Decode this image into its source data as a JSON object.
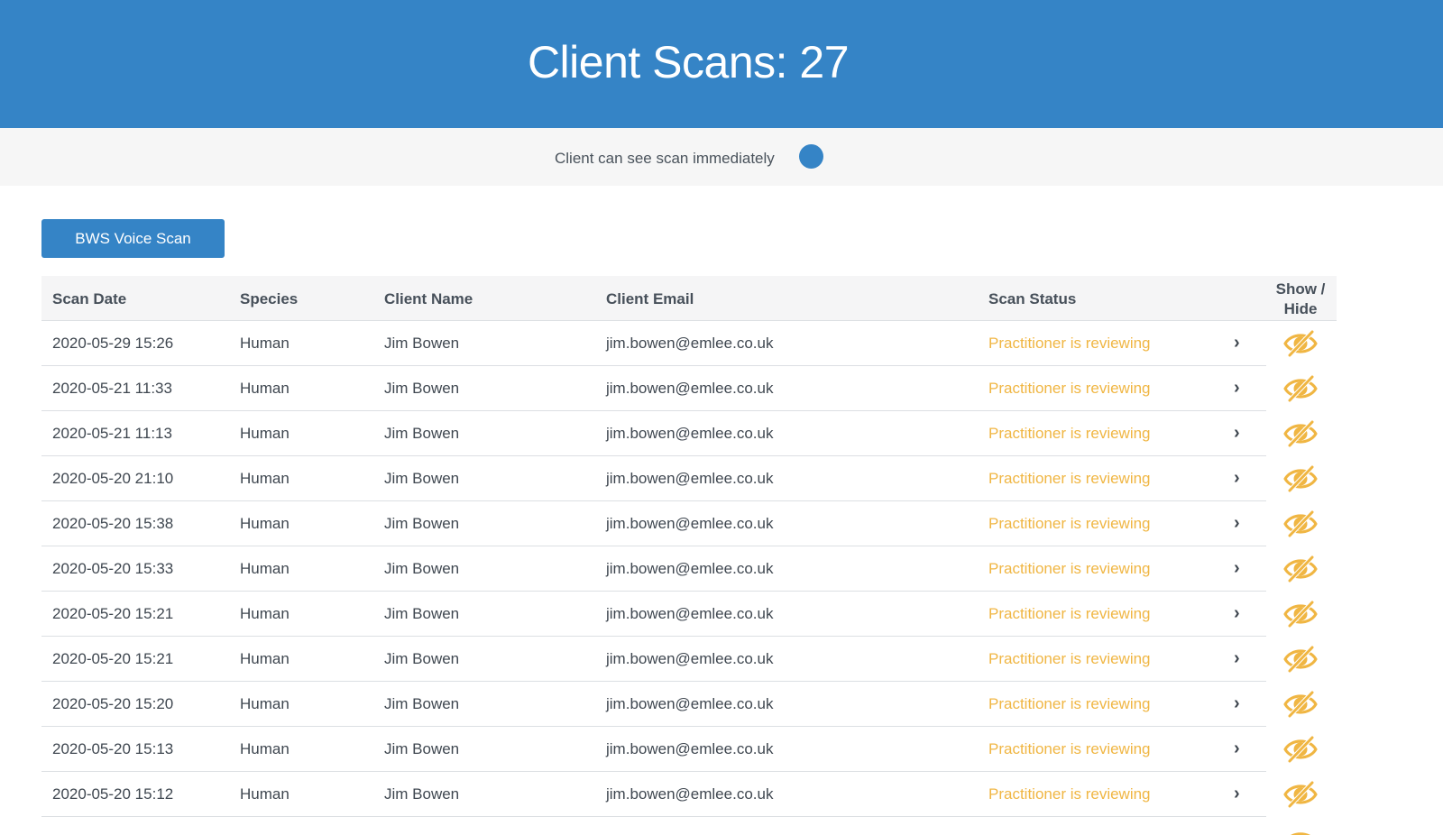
{
  "header": {
    "title": "Client Scans: 27"
  },
  "toggle": {
    "label": "Client can see scan immediately",
    "color": "#3584c6"
  },
  "actions": {
    "scan_button_label": "BWS Voice Scan"
  },
  "table": {
    "columns": {
      "scan_date": "Scan Date",
      "species": "Species",
      "client_name": "Client Name",
      "client_email": "Client Email",
      "scan_status": "Scan Status",
      "show_hide_line1": "Show /",
      "show_hide_line2": "Hide"
    },
    "rows": [
      {
        "date": "2020-05-29 15:26",
        "species": "Human",
        "name": "Jim Bowen",
        "email": "jim.bowen@emlee.co.uk",
        "status": "Practitioner is reviewing"
      },
      {
        "date": "2020-05-21 11:33",
        "species": "Human",
        "name": "Jim Bowen",
        "email": "jim.bowen@emlee.co.uk",
        "status": "Practitioner is reviewing"
      },
      {
        "date": "2020-05-21 11:13",
        "species": "Human",
        "name": "Jim Bowen",
        "email": "jim.bowen@emlee.co.uk",
        "status": "Practitioner is reviewing"
      },
      {
        "date": "2020-05-20 21:10",
        "species": "Human",
        "name": "Jim Bowen",
        "email": "jim.bowen@emlee.co.uk",
        "status": "Practitioner is reviewing"
      },
      {
        "date": "2020-05-20 15:38",
        "species": "Human",
        "name": "Jim Bowen",
        "email": "jim.bowen@emlee.co.uk",
        "status": "Practitioner is reviewing"
      },
      {
        "date": "2020-05-20 15:33",
        "species": "Human",
        "name": "Jim Bowen",
        "email": "jim.bowen@emlee.co.uk",
        "status": "Practitioner is reviewing"
      },
      {
        "date": "2020-05-20 15:21",
        "species": "Human",
        "name": "Jim Bowen",
        "email": "jim.bowen@emlee.co.uk",
        "status": "Practitioner is reviewing"
      },
      {
        "date": "2020-05-20 15:21",
        "species": "Human",
        "name": "Jim Bowen",
        "email": "jim.bowen@emlee.co.uk",
        "status": "Practitioner is reviewing"
      },
      {
        "date": "2020-05-20 15:20",
        "species": "Human",
        "name": "Jim Bowen",
        "email": "jim.bowen@emlee.co.uk",
        "status": "Practitioner is reviewing"
      },
      {
        "date": "2020-05-20 15:13",
        "species": "Human",
        "name": "Jim Bowen",
        "email": "jim.bowen@emlee.co.uk",
        "status": "Practitioner is reviewing"
      },
      {
        "date": "2020-05-20 15:12",
        "species": "Human",
        "name": "Jim Bowen",
        "email": "jim.bowen@emlee.co.uk",
        "status": "Practitioner is reviewing"
      }
    ],
    "row_icons": {
      "open": "chevron-right-icon",
      "visibility": "eye-slash-icon"
    },
    "status_color": "#f0b643"
  }
}
